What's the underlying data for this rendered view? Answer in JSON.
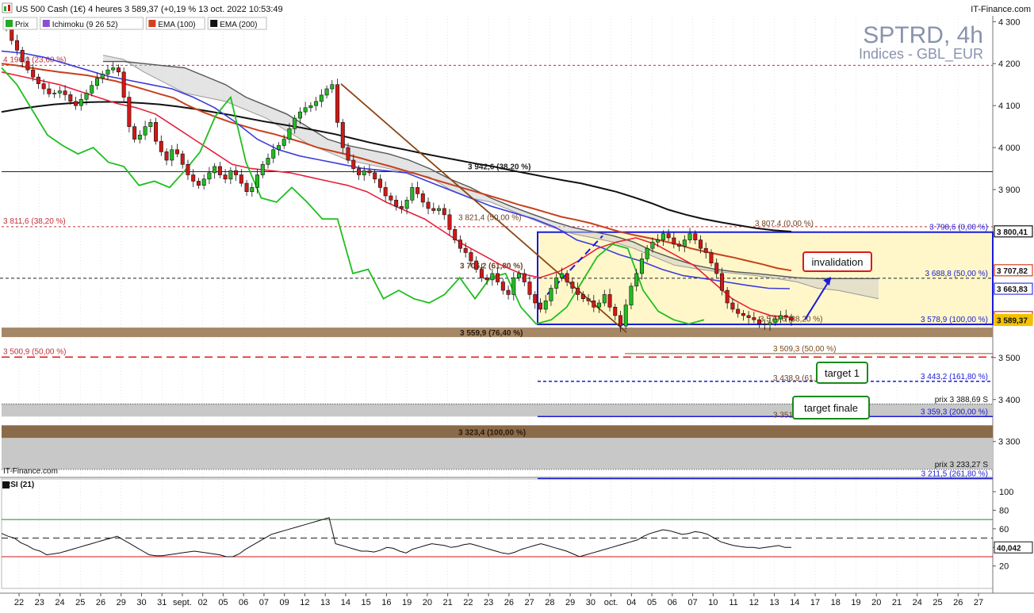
{
  "header": {
    "title": "US 500 Cash (1€) 4 heures 3 589,37 (+0,19 % 13 oct. 2022 10:53:49",
    "brand": "IT-Finance.com"
  },
  "legend": [
    {
      "label": "Prix",
      "color": "#22aa22"
    },
    {
      "label": "Ichimoku (9 26 52)",
      "color": "#8a4fd0"
    },
    {
      "label": "EMA (100)",
      "color": "#d2411e"
    },
    {
      "label": "EMA (200)",
      "color": "#111111"
    }
  ],
  "watermark": {
    "symbol": "SPTRD, 4h",
    "subtitle": "Indices - GBL_EUR"
  },
  "footer_brand": "IT-Finance.com",
  "chart_data": [
    {
      "type": "candlestick",
      "price_axis": {
        "ticks": [
          "4 300",
          "4 200",
          "4 100",
          "4 000",
          "3 900",
          "3 500",
          "3 400",
          "3 300"
        ],
        "range": [
          3230,
          4310
        ]
      },
      "x_labels": [
        "22",
        "23",
        "24",
        "25",
        "26",
        "29",
        "30",
        "31",
        "sept.",
        "02",
        "05",
        "06",
        "07",
        "09",
        "12",
        "13",
        "14",
        "15",
        "16",
        "19",
        "20",
        "21",
        "22",
        "23",
        "26",
        "27",
        "28",
        "29",
        "30",
        "oct.",
        "04",
        "05",
        "06",
        "07",
        "10",
        "11",
        "12",
        "13",
        "14",
        "17",
        "18",
        "19",
        "20",
        "21",
        "24",
        "25",
        "26",
        "27"
      ],
      "price_tags": [
        {
          "value": "3 800,41",
          "color": "#111111"
        },
        {
          "value": "3 707,82",
          "color": "#d2411e"
        },
        {
          "value": "3 663,83",
          "color": "#3a3ad8"
        },
        {
          "value": "3 596,38",
          "color": "#e8203a"
        },
        {
          "value": "3 589,37",
          "color": "#f2c200"
        }
      ],
      "levels": [
        {
          "label": "4 196,0 (23,60 %)",
          "price": 4196,
          "style": "dashed-red"
        },
        {
          "label": "3 942,6 (38,20 %)",
          "price": 3942.6,
          "style": "solid-dark"
        },
        {
          "label": "3 811,6 (38,20 %)",
          "price": 3811.6,
          "style": "dashed-red"
        },
        {
          "label": "3 821,4 (50,00 %)",
          "price": 3821.4,
          "style": "marker"
        },
        {
          "label": "3 807,4 (0,00 %)",
          "price": 3807.4,
          "style": "marker"
        },
        {
          "label": "3 798,6 (0,00 %)",
          "price": 3798.6,
          "style": "solid-blue"
        },
        {
          "label": "3 706,2 (61,80 %)",
          "price": 3706.2,
          "style": "marker"
        },
        {
          "label": "3 688,8 (50,00 %)",
          "price": 3688.8,
          "style": "dashed-dark"
        },
        {
          "label": "3 579,6 (38,20 %)",
          "price": 3579.6,
          "style": "marker"
        },
        {
          "label": "3 578,9 (100,00 %)",
          "price": 3578.9,
          "style": "solid-blue"
        },
        {
          "label": "3 559,9 (76,40 %)",
          "price": 3559.9,
          "style": "band-brown"
        },
        {
          "label": "3 509,3 (50,00 %)",
          "price": 3509.3,
          "style": "solid-brown"
        },
        {
          "label": "3 500,9 (50,00 %)",
          "price": 3500.9,
          "style": "dashed-red"
        },
        {
          "label": "3 443,2 (161,80 %)",
          "price": 3443.2,
          "style": "dashed-blue"
        },
        {
          "label": "3 438,9 (61,80 %)",
          "price": 3438.9,
          "style": "marker"
        },
        {
          "label": "prix 3 388,69 S",
          "price": 3388.69,
          "style": "support"
        },
        {
          "label": "3 359,3 (200,00 %)",
          "price": 3359.3,
          "style": "solid-blue"
        },
        {
          "label": "3 351,1 (78,60 %)",
          "price": 3351.1,
          "style": "marker"
        },
        {
          "label": "3 323,4 (100,00 %)",
          "price": 3323.4,
          "style": "band-brown"
        },
        {
          "label": "prix 3 233,27 S",
          "price": 3233.27,
          "style": "support"
        },
        {
          "label": "3 211,5 (261,80 %)",
          "price": 3211.5,
          "style": "solid-blue"
        }
      ],
      "annotations": [
        "invalidation",
        "target 1",
        "target finale"
      ],
      "ohlc_close": [
        4285,
        4255,
        4232,
        4205,
        4185,
        4168,
        4152,
        4140,
        4128,
        4130,
        4135,
        4126,
        4110,
        4100,
        4115,
        4130,
        4148,
        4165,
        4175,
        4185,
        4190,
        4180,
        4120,
        4050,
        4020,
        4030,
        4050,
        4060,
        4015,
        3990,
        3970,
        3995,
        3985,
        3960,
        3935,
        3920,
        3910,
        3925,
        3940,
        3955,
        3935,
        3925,
        3945,
        3935,
        3915,
        3895,
        3905,
        3935,
        3960,
        3975,
        3995,
        4005,
        4020,
        4045,
        4070,
        4085,
        4095,
        4100,
        4110,
        4125,
        4140,
        4150,
        4060,
        4000,
        3970,
        3950,
        3935,
        3945,
        3940,
        3925,
        3905,
        3885,
        3875,
        3860,
        3855,
        3875,
        3905,
        3890,
        3870,
        3855,
        3850,
        3855,
        3840,
        3805,
        3780,
        3760,
        3750,
        3730,
        3710,
        3690,
        3685,
        3700,
        3680,
        3660,
        3650,
        3690,
        3700,
        3680,
        3650,
        3630,
        3615,
        3635,
        3665,
        3690,
        3700,
        3680,
        3665,
        3650,
        3640,
        3635,
        3620,
        3630,
        3650,
        3620,
        3600,
        3575,
        3625,
        3670,
        3700,
        3735,
        3760,
        3775,
        3780,
        3795,
        3785,
        3770,
        3765,
        3780,
        3795,
        3780,
        3760,
        3750,
        3725,
        3700,
        3660,
        3630,
        3615,
        3605,
        3600,
        3595,
        3590,
        3580,
        3578,
        3583,
        3592,
        3600,
        3596,
        3589
      ],
      "ema100": [
        4200,
        4196,
        4190,
        4185,
        4180,
        4176,
        4172,
        4165,
        4158,
        4148,
        4138,
        4128,
        4118,
        4100,
        4085,
        4072,
        4060,
        4050,
        4040,
        4032,
        4022,
        4012,
        4000,
        3992,
        3984,
        3975,
        3965,
        3956,
        3946,
        3936,
        3925,
        3915,
        3905,
        3895,
        3885,
        3875,
        3864,
        3855,
        3845,
        3835,
        3828,
        3820,
        3810,
        3800,
        3792,
        3785,
        3778,
        3770,
        3760,
        3752,
        3745,
        3738,
        3730,
        3722,
        3713,
        3707
      ],
      "ema200": [
        4085,
        4092,
        4098,
        4103,
        4106,
        4108,
        4109,
        4108,
        4106,
        4103,
        4098,
        4092,
        4085,
        4078,
        4070,
        4062,
        4055,
        4048,
        4040,
        4032,
        4022,
        4012,
        4003,
        3995,
        3986,
        3978,
        3970,
        3962,
        3955,
        3946,
        3938,
        3930,
        3922,
        3915,
        3905,
        3895,
        3882,
        3868,
        3852,
        3840,
        3830,
        3822,
        3815,
        3808,
        3803,
        3800
      ],
      "kijun": [
        4230,
        4225,
        4215,
        4200,
        4185,
        4170,
        4160,
        4150,
        4140,
        4120,
        4095,
        4060,
        4020,
        3995,
        3980,
        3970,
        3960,
        3950,
        3945,
        3940,
        3920,
        3900,
        3880,
        3860,
        3845,
        3830,
        3810,
        3780,
        3765,
        3745,
        3730,
        3710,
        3695,
        3688,
        3680,
        3672,
        3665,
        3664
      ],
      "tenkan": [
        4180,
        4170,
        4160,
        4150,
        4135,
        4120,
        4105,
        4095,
        4080,
        4050,
        4020,
        3990,
        3960,
        3950,
        3945,
        3940,
        3930,
        3920,
        3910,
        3895,
        3870,
        3850,
        3830,
        3800,
        3770,
        3745,
        3720,
        3700,
        3690,
        3705,
        3730,
        3760,
        3775,
        3785,
        3770,
        3745,
        3720,
        3680,
        3640,
        3615,
        3600,
        3596
      ],
      "chikou": [
        4190,
        4150,
        4090,
        4030,
        4005,
        3985,
        4000,
        3965,
        3955,
        3910,
        3920,
        3905,
        3945,
        3990,
        4075,
        4120,
        3965,
        3880,
        3870,
        3905,
        3870,
        3830,
        3830,
        3700,
        3710,
        3640,
        3660,
        3640,
        3630,
        3650,
        3690,
        3640,
        3690,
        3700,
        3620,
        3580,
        3590,
        3620,
        3680,
        3740,
        3770,
        3760,
        3660,
        3610,
        3590,
        3580,
        3590
      ],
      "kumo_a": [
        4220,
        4210,
        4180,
        4155,
        4130,
        4120,
        4110,
        4090,
        4070,
        4040,
        4010,
        3990,
        3970,
        3960,
        3950,
        3940,
        3930,
        3900,
        3880,
        3870,
        3850,
        3830,
        3810,
        3795,
        3785,
        3775,
        3760,
        3740,
        3720,
        3712,
        3705,
        3700,
        3695,
        3688,
        3680,
        3665,
        3660,
        3650,
        3640
      ],
      "kumo_b": [
        4205,
        4205,
        4200,
        4195,
        4190,
        4170,
        4150,
        4120,
        4100,
        4080,
        4050,
        4020,
        4005,
        3995,
        3985,
        3970,
        3950,
        3925,
        3905,
        3880,
        3860,
        3842,
        3825,
        3810,
        3800,
        3790,
        3775,
        3752,
        3735,
        3720,
        3710,
        3704,
        3700,
        3695,
        3690,
        3688,
        3688,
        3688,
        3688
      ],
      "rsi": {
        "label": "RSI (21)",
        "ticks": [
          "100",
          "80",
          "60",
          "40",
          "20"
        ],
        "levels": [
          70,
          50,
          30
        ],
        "last": "40,042",
        "values": [
          55,
          52,
          50,
          45,
          42,
          38,
          36,
          32,
          33,
          34,
          36,
          38,
          40,
          42,
          44,
          46,
          48,
          50,
          52,
          48,
          44,
          40,
          36,
          32,
          31,
          31,
          32,
          33,
          34,
          35,
          36,
          35,
          34,
          33,
          32,
          30,
          30,
          33,
          38,
          42,
          46,
          50,
          54,
          56,
          58,
          60,
          62,
          64,
          66,
          68,
          70,
          72,
          44,
          42,
          40,
          38,
          36,
          36,
          35,
          37,
          40,
          39,
          36,
          34,
          38,
          40,
          42,
          44,
          43,
          42,
          40,
          41,
          43,
          44,
          42,
          40,
          38,
          36,
          34,
          33,
          35,
          38,
          40,
          42,
          44,
          42,
          40,
          38,
          36,
          33,
          30,
          32,
          34,
          36,
          38,
          40,
          42,
          44,
          46,
          48,
          52,
          55,
          57,
          59,
          58,
          56,
          54,
          55,
          57,
          56,
          54,
          50,
          46,
          44,
          42,
          41,
          40,
          40,
          39,
          40,
          41,
          42,
          40,
          40
        ]
      }
    }
  ]
}
